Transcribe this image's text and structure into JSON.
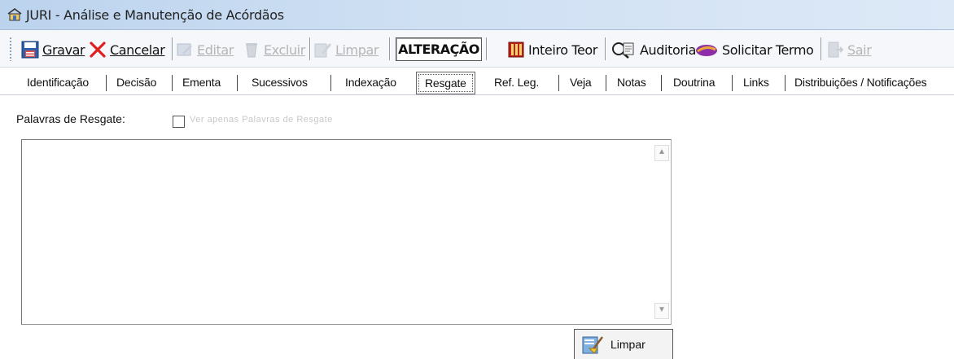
{
  "window": {
    "title": "JURI - Análise e Manutenção de Acórdãos"
  },
  "toolbar": {
    "gravar": "Gravar",
    "cancelar": "Cancelar",
    "editar": "Editar",
    "excluir": "Excluir",
    "limpar": "Limpar",
    "mode": "ALTERAÇÃO",
    "inteiro_teor": "Inteiro Teor",
    "auditoria": "Auditoria",
    "solicitar_termo": "Solicitar Termo",
    "sair": "Sair"
  },
  "tabs": [
    {
      "label": "Identificação"
    },
    {
      "label": "Decisão"
    },
    {
      "label": "Ementa"
    },
    {
      "label": "Sucessivos"
    },
    {
      "label": "Indexação"
    },
    {
      "label": "Resgate",
      "active": true
    },
    {
      "label": "Ref. Leg."
    },
    {
      "label": "Veja"
    },
    {
      "label": "Notas"
    },
    {
      "label": "Doutrina"
    },
    {
      "label": "Links"
    },
    {
      "label": "Distribuições / Notificações"
    }
  ],
  "resgate": {
    "label": "Palavras de Resgate:",
    "checkbox_label": "Ver apenas Palavras de Resgate",
    "checkbox_checked": false,
    "text_value": "",
    "clear_button": "Limpar"
  }
}
